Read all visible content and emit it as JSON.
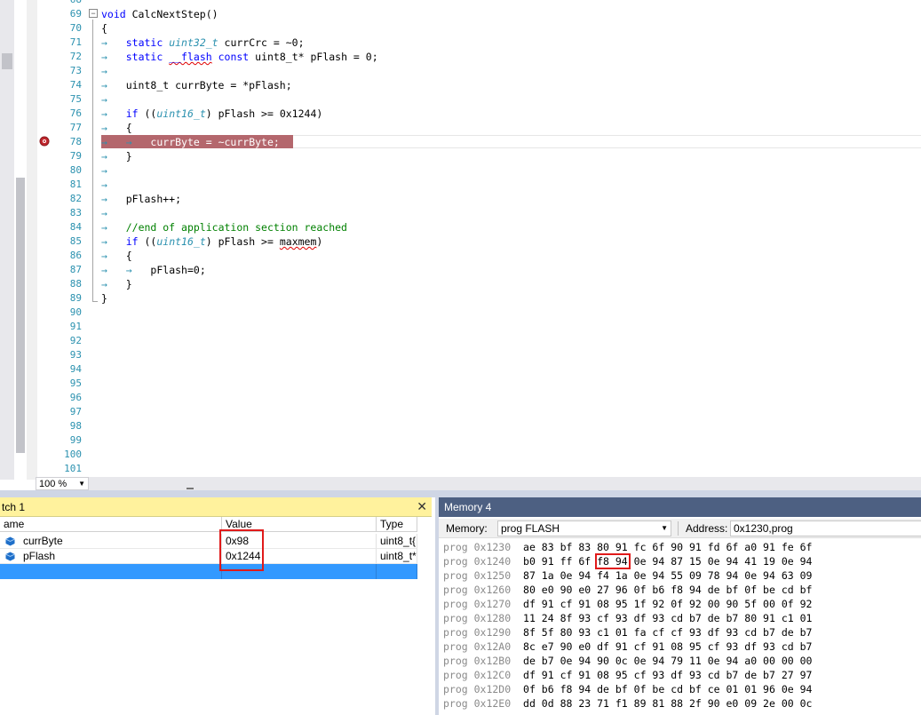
{
  "editor": {
    "lines": [
      {
        "num": "68",
        "text": ""
      },
      {
        "num": "69",
        "text": "void CalcNextStep()"
      },
      {
        "num": "70",
        "text": "{"
      },
      {
        "num": "71",
        "text": "static uint32_t currCrc = ~0;"
      },
      {
        "num": "72",
        "text": "static __flash const uint8_t* pFlash = 0;"
      },
      {
        "num": "73",
        "text": ""
      },
      {
        "num": "74",
        "text": "uint8_t currByte = *pFlash;"
      },
      {
        "num": "75",
        "text": ""
      },
      {
        "num": "76",
        "text": "if ((uint16_t) pFlash >= 0x1244)"
      },
      {
        "num": "77",
        "text": "{"
      },
      {
        "num": "78",
        "text": "currByte = ~currByte;"
      },
      {
        "num": "79",
        "text": "}"
      },
      {
        "num": "80",
        "text": ""
      },
      {
        "num": "81",
        "text": ""
      },
      {
        "num": "82",
        "text": "pFlash++;"
      },
      {
        "num": "83",
        "text": ""
      },
      {
        "num": "84",
        "text": "//end of application section reached"
      },
      {
        "num": "85",
        "text": "if ((uint16_t) pFlash >= maxmem)"
      },
      {
        "num": "86",
        "text": "{"
      },
      {
        "num": "87",
        "text": "pFlash=0;"
      },
      {
        "num": "88",
        "text": "}"
      },
      {
        "num": "89",
        "text": "}"
      },
      {
        "num": "90",
        "text": ""
      },
      {
        "num": "91",
        "text": ""
      },
      {
        "num": "92",
        "text": ""
      },
      {
        "num": "93",
        "text": ""
      },
      {
        "num": "94",
        "text": ""
      },
      {
        "num": "95",
        "text": ""
      },
      {
        "num": "96",
        "text": ""
      },
      {
        "num": "97",
        "text": ""
      },
      {
        "num": "98",
        "text": ""
      },
      {
        "num": "99",
        "text": ""
      },
      {
        "num": "100",
        "text": ""
      },
      {
        "num": "101",
        "text": ""
      }
    ],
    "zoom": "100 %"
  },
  "watch": {
    "title": "tch 1",
    "close_glyph": "✕",
    "columns": {
      "name": "ame",
      "value": "Value",
      "type": "Type"
    },
    "rows": [
      {
        "name": "currByte",
        "value": "0x98",
        "type": "uint8_t{"
      },
      {
        "name": "pFlash",
        "value": "0x1244",
        "type": "uint8_t*"
      }
    ]
  },
  "memory": {
    "title": "Memory 4",
    "memory_label": "Memory:",
    "memory_space": "prog FLASH",
    "address_label": "Address:",
    "address_value": "0x1230,prog",
    "rows": [
      {
        "addr": "prog 0x1230",
        "bytes": "ae 83 bf 83 80 91 fc 6f 90 91 fd 6f a0 91 fe 6f"
      },
      {
        "addr": "prog 0x1240",
        "bytes": "b0 91 ff 6f f8 94 0e 94 87 15 0e 94 41 19 0e 94"
      },
      {
        "addr": "prog 0x1250",
        "bytes": "87 1a 0e 94 f4 1a 0e 94 55 09 78 94 0e 94 63 09"
      },
      {
        "addr": "prog 0x1260",
        "bytes": "80 e0 90 e0 27 96 0f b6 f8 94 de bf 0f be cd bf"
      },
      {
        "addr": "prog 0x1270",
        "bytes": "df 91 cf 91 08 95 1f 92 0f 92 00 90 5f 00 0f 92"
      },
      {
        "addr": "prog 0x1280",
        "bytes": "11 24 8f 93 cf 93 df 93 cd b7 de b7 80 91 c1 01"
      },
      {
        "addr": "prog 0x1290",
        "bytes": "8f 5f 80 93 c1 01 fa cf cf 93 df 93 cd b7 de b7"
      },
      {
        "addr": "prog 0x12A0",
        "bytes": "8c e7 90 e0 df 91 cf 91 08 95 cf 93 df 93 cd b7"
      },
      {
        "addr": "prog 0x12B0",
        "bytes": "de b7 0e 94 90 0c 0e 94 79 11 0e 94 a0 00 00 00"
      },
      {
        "addr": "prog 0x12C0",
        "bytes": "df 91 cf 91 08 95 cf 93 df 93 cd b7 de b7 27 97"
      },
      {
        "addr": "prog 0x12D0",
        "bytes": "0f b6 f8 94 de bf 0f be cd bf ce 01 01 96 0e 94"
      },
      {
        "addr": "prog 0x12E0",
        "bytes": "dd 0d 88 23 71 f1 89 81 88 2f 90 e0 09 2e 00 0c"
      }
    ]
  },
  "colors": {
    "breakpoint_highlight": "#b4676d",
    "watch_title_bg": "#fff29d",
    "memory_title_bg": "#4d6082",
    "selection_blue": "#3399ff",
    "annotation_red": "#e01a1a"
  },
  "icons": {
    "breakpoint": "breakpoint-icon",
    "watch_variable": "variable-icon",
    "close": "close-icon"
  }
}
